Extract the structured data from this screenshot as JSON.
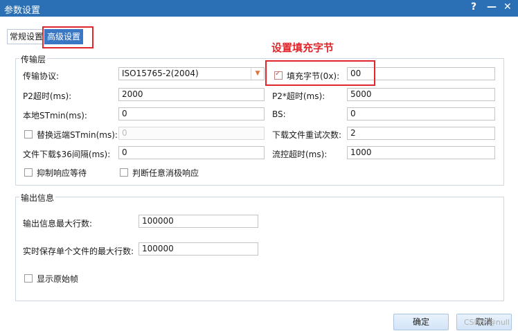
{
  "window": {
    "title": "参数设置",
    "help": "?",
    "minimize": "—",
    "close": "✕"
  },
  "tabs": [
    {
      "label": "常规设置"
    },
    {
      "label": "高级设置"
    }
  ],
  "annotation": "设置填充字节",
  "transport": {
    "title": "传输层",
    "protocol_label": "传输协议:",
    "protocol_value": "ISO15765-2(2004)",
    "fill_label": "填充字节(0x):",
    "fill_checked": true,
    "fill_value": "00",
    "p2_label": "P2超时(ms):",
    "p2_value": "2000",
    "p2star_label": "P2*超时(ms):",
    "p2star_value": "5000",
    "stmin_label": "本地STmin(ms):",
    "stmin_value": "0",
    "bs_label": "BS:",
    "bs_value": "0",
    "replace_stmin_label": "替换远端STmin(ms):",
    "replace_stmin_value": "0",
    "retry_label": "下载文件重试次数:",
    "retry_value": "2",
    "interval_label": "文件下载$36间隔(ms):",
    "interval_value": "0",
    "flow_label": "流控超时(ms):",
    "flow_value": "1000",
    "suppress_label": "抑制响应等待",
    "negative_label": "判断任意消极响应"
  },
  "output": {
    "title": "输出信息",
    "max_lines_label": "输出信息最大行数:",
    "max_lines_value": "100000",
    "file_lines_label": "实时保存单个文件的最大行数:",
    "file_lines_value": "100000",
    "raw_frame_label": "显示原始帧"
  },
  "buttons": {
    "ok": "确定",
    "cancel": "取消"
  },
  "watermark": "CSDN @null"
}
